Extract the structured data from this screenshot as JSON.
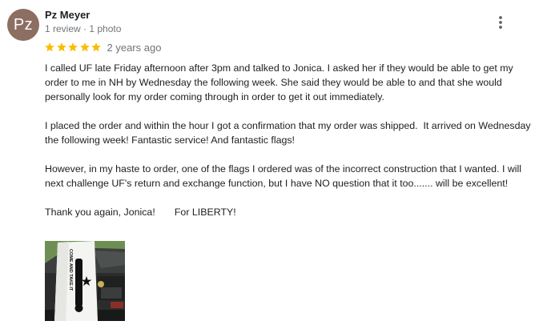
{
  "reviewer": {
    "avatar_initials": "Pz",
    "avatar_color": "#8d6e63",
    "name": "Pz Meyer",
    "meta": "1 review · 1 photo"
  },
  "rating": {
    "stars": 5,
    "star_color": "#fbbc04",
    "time_ago": "2 years ago"
  },
  "menu": {
    "icon": "more-vert-icon"
  },
  "review": {
    "paragraphs": [
      "I called UF late Friday afternoon after 3pm and talked to Jonica. I asked her if they would be able to get my order to me in NH by Wednesday the following week. She said they would be able to and that she would personally look for my order coming through in order to get it out immediately.",
      "I placed the order and within the hour I got a confirmation that my order was shipped.  It arrived on Wednesday the following week! Fantastic service! And fantastic flags!",
      "However, in my haste to order, one of the flags I ordered was of the incorrect construction that I wanted. I will next challenge UF's return and exchange function, but I have NO question that it too....... will be excellent!",
      "Thank you again, Jonica!       For LIBERTY!"
    ]
  },
  "photo": {
    "flag_text": "COME AND TAKE IT"
  }
}
